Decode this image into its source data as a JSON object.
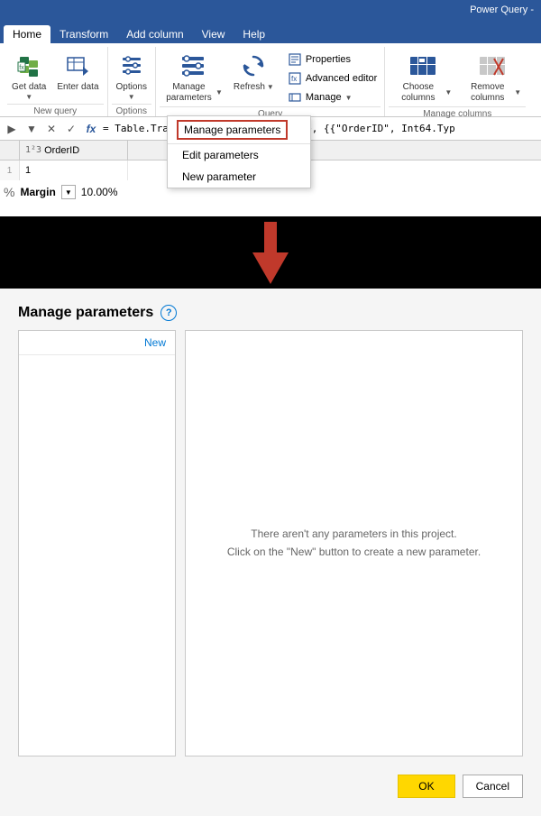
{
  "titlebar": {
    "text": "Power Query -"
  },
  "tabs": [
    {
      "label": "Home",
      "active": true
    },
    {
      "label": "Transform",
      "active": false
    },
    {
      "label": "Add column",
      "active": false
    },
    {
      "label": "View",
      "active": false
    },
    {
      "label": "Help",
      "active": false
    }
  ],
  "ribbon": {
    "new_query_group": "New query",
    "options_group": "Options",
    "query_group": "Query",
    "manage_columns_group": "Manage columns",
    "buttons": {
      "get_data": "Get data",
      "enter_data": "Enter data",
      "options": "Options",
      "manage_parameters": "Manage parameters",
      "refresh": "Refresh",
      "properties": "Properties",
      "advanced_editor": "Advanced editor",
      "manage": "Manage",
      "choose_columns": "Choose columns",
      "remove_columns": "Remove columns"
    }
  },
  "dropdown": {
    "highlighted_item": "Manage parameters",
    "items": [
      "Edit parameters",
      "New parameter"
    ]
  },
  "formula_bar": {
    "content": "= Table.TransformColumnTypes(Source, {{\"OrderID\", Int64.Typ"
  },
  "grid": {
    "column_type": "1²3",
    "column_name": "OrderID",
    "row_value": "1"
  },
  "margin": {
    "label": "Margin",
    "value": "10.00%"
  },
  "dialog": {
    "title": "Manage parameters",
    "help_icon": "?",
    "new_link": "New",
    "empty_state_line1": "There aren't any parameters in this project.",
    "empty_state_line2": "Click on the \"New\" button to create a new parameter.",
    "ok_button": "OK",
    "cancel_button": "Cancel"
  }
}
